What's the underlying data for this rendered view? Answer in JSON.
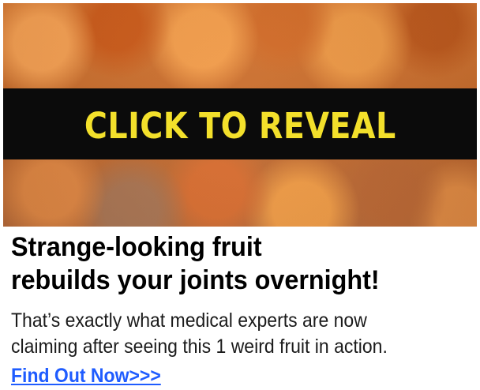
{
  "ad": {
    "hero": {
      "reveal_label": "CLICK TO REVEAL"
    },
    "headline_lines": [
      "Strange-looking fruit",
      "rebuilds your joints overnight!"
    ],
    "body_lines": [
      "That’s exactly what medical experts are now",
      "claiming after seeing this 1 weird fruit in action."
    ],
    "cta_text": "Find Out Now>>>"
  },
  "colors": {
    "reveal_band": "#0b0b0b",
    "reveal_text": "#f3e02b",
    "headline_text": "#000000",
    "body_text": "#1b1b1b",
    "link_text": "#1f5cff",
    "page_background": "#ffffff"
  }
}
